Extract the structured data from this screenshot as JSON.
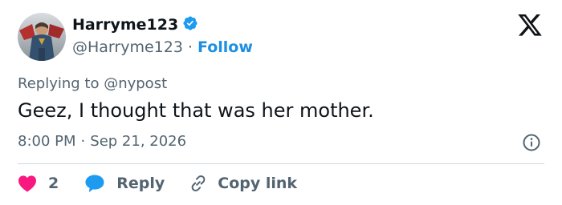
{
  "author": {
    "display_name": "Harryme123",
    "handle": "@Harryme123",
    "verified": true,
    "separator": "·",
    "follow_label": "Follow"
  },
  "brand": {
    "icon": "x-logo-icon"
  },
  "tweet": {
    "replying_to": "Replying to @nypost",
    "text": "Geez, I thought that was her mother.",
    "time": "8:00 PM",
    "separator": "·",
    "date": "Sep 21, 2026"
  },
  "actions": {
    "like_count": "2",
    "reply_label": "Reply",
    "copy_link_label": "Copy link"
  },
  "colors": {
    "accent": "#1d9bf0",
    "like": "#f91880",
    "text_primary": "#0f1419",
    "text_secondary": "#536471",
    "divider": "#cfd9de"
  },
  "icons": {
    "verified": "verified-badge-icon",
    "info": "info-icon",
    "like": "heart-icon",
    "reply": "speech-bubble-icon",
    "copy": "link-icon"
  }
}
